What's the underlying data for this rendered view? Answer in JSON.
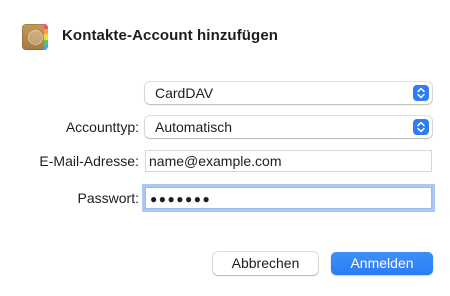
{
  "dialog": {
    "title": "Kontakte-Account hinzufügen",
    "app_icon": "contacts-app-icon"
  },
  "form": {
    "server_type": {
      "value": "CardDAV"
    },
    "account_type": {
      "label": "Accounttyp:",
      "value": "Automatisch"
    },
    "email": {
      "label": "E-Mail-Adresse:",
      "value": "name@example.com"
    },
    "password": {
      "label": "Passwort:",
      "masked": "●●●●●●●"
    }
  },
  "buttons": {
    "cancel_label": "Abbrechen",
    "submit_label": "Anmelden"
  },
  "colors": {
    "accent": "#2e7cf6",
    "focus_ring": "#a9c8f2"
  }
}
